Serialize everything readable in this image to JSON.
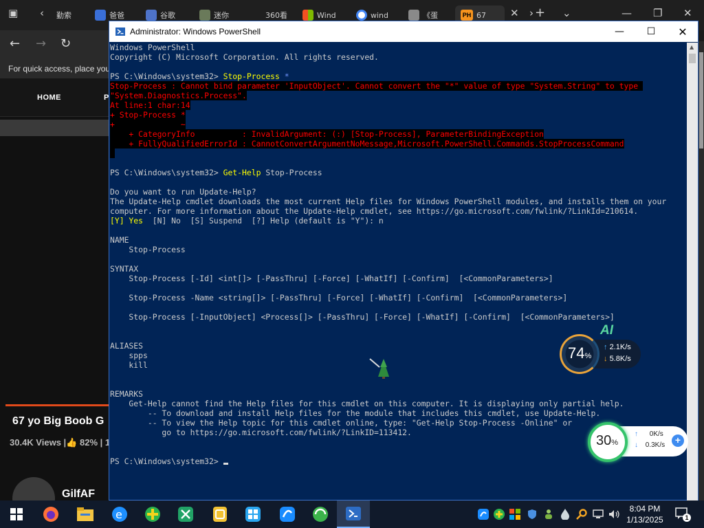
{
  "browser": {
    "tabs": [
      {
        "label": "勤索"
      },
      {
        "label": "爸爸"
      },
      {
        "label": "谷歌"
      },
      {
        "label": "迷你"
      },
      {
        "label": "360看"
      },
      {
        "label": "Wind"
      },
      {
        "label": "wind"
      },
      {
        "label": "《蛋"
      },
      {
        "label": "67"
      }
    ],
    "active_tab_badge": "PH",
    "quick_access": "For quick access, place your",
    "site": {
      "menu_home": "HOME",
      "menu_next": "P",
      "video_title": "67 yo Big Boob G",
      "views": "30.4K Views",
      "rating": "82%",
      "rating_sep": "| 1",
      "channel": "GilfAF"
    }
  },
  "powershell": {
    "title": "Administrator: Windows PowerShell",
    "lines": [
      {
        "type": "out",
        "text": "Windows PowerShell"
      },
      {
        "type": "out",
        "text": "Copyright (C) Microsoft Corporation. All rights reserved."
      },
      {
        "type": "out",
        "text": ""
      },
      {
        "type": "prompt",
        "prompt": "PS C:\\Windows\\system32> ",
        "cmd": "Stop-Process",
        "arg": " *",
        "argcolor": "#6f94ff"
      },
      {
        "type": "err",
        "text": "Stop-Process : Cannot bind parameter 'InputObject'. Cannot convert the \"*\" value of type \"System.String\" to type "
      },
      {
        "type": "err",
        "text": "\"System.Diagnostics.Process\"."
      },
      {
        "type": "err",
        "text": "At line:1 char:14"
      },
      {
        "type": "err",
        "text": "+ Stop-Process *"
      },
      {
        "type": "err",
        "text": "+              ~"
      },
      {
        "type": "err",
        "text": "    + CategoryInfo          : InvalidArgument: (:) [Stop-Process], ParameterBindingException"
      },
      {
        "type": "err",
        "text": "    + FullyQualifiedErrorId : CannotConvertArgumentNoMessage,Microsoft.PowerShell.Commands.StopProcessCommand"
      },
      {
        "type": "err",
        "text": " "
      },
      {
        "type": "out",
        "text": ""
      },
      {
        "type": "prompt",
        "prompt": "PS C:\\Windows\\system32> ",
        "cmd": "Get-Help",
        "arg": " Stop-Process",
        "argcolor": "#cccccc"
      },
      {
        "type": "out",
        "text": ""
      },
      {
        "type": "out",
        "text": "Do you want to run Update-Help?"
      },
      {
        "type": "out",
        "text": "The Update-Help cmdlet downloads the most current Help files for Windows PowerShell modules, and installs them on your"
      },
      {
        "type": "out",
        "text": "computer. For more information about the Update-Help cmdlet, see https://go.microsoft.com/fwlink/?LinkId=210614."
      },
      {
        "type": "choice",
        "yes": "[Y] Yes",
        "rest": "  [N] No  [S] Suspend  [?] Help (default is \"Y\"): n"
      },
      {
        "type": "out",
        "text": ""
      },
      {
        "type": "out",
        "text": "NAME"
      },
      {
        "type": "out",
        "text": "    Stop-Process"
      },
      {
        "type": "out",
        "text": ""
      },
      {
        "type": "out",
        "text": "SYNTAX"
      },
      {
        "type": "out",
        "text": "    Stop-Process [-Id] <int[]> [-PassThru] [-Force] [-WhatIf] [-Confirm]  [<CommonParameters>]"
      },
      {
        "type": "out",
        "text": ""
      },
      {
        "type": "out",
        "text": "    Stop-Process -Name <string[]> [-PassThru] [-Force] [-WhatIf] [-Confirm]  [<CommonParameters>]"
      },
      {
        "type": "out",
        "text": ""
      },
      {
        "type": "out",
        "text": "    Stop-Process [-InputObject] <Process[]> [-PassThru] [-Force] [-WhatIf] [-Confirm]  [<CommonParameters>]"
      },
      {
        "type": "out",
        "text": ""
      },
      {
        "type": "out",
        "text": ""
      },
      {
        "type": "out",
        "text": "ALIASES"
      },
      {
        "type": "out",
        "text": "    spps"
      },
      {
        "type": "out",
        "text": "    kill"
      },
      {
        "type": "out",
        "text": ""
      },
      {
        "type": "out",
        "text": ""
      },
      {
        "type": "out",
        "text": "REMARKS"
      },
      {
        "type": "out",
        "text": "    Get-Help cannot find the Help files for this cmdlet on this computer. It is displaying only partial help."
      },
      {
        "type": "out",
        "text": "        -- To download and install Help files for the module that includes this cmdlet, use Update-Help."
      },
      {
        "type": "out",
        "text": "        -- To view the Help topic for this cmdlet online, type: \"Get-Help Stop-Process -Online\" or"
      },
      {
        "type": "out",
        "text": "           go to https://go.microsoft.com/fwlink/?LinkID=113412."
      },
      {
        "type": "out",
        "text": ""
      },
      {
        "type": "out",
        "text": ""
      },
      {
        "type": "prompt_cursor",
        "prompt": "PS C:\\Windows\\system32> "
      }
    ]
  },
  "widgets": {
    "ai_label": "AI",
    "w1": {
      "percent": "74",
      "pct_sign": "%",
      "up": "2.1K/s",
      "down": "5.8K/s"
    },
    "w2": {
      "percent": "30",
      "pct_sign": "%",
      "up": "0K/s",
      "down": "0.3K/s",
      "plus": "+"
    }
  },
  "taskbar": {
    "time": "8:04 PM",
    "date": "1/13/2025",
    "notification_count": "1",
    "colors": {
      "bg": "#101a2b",
      "ps_bg": "#012456",
      "cmd": "#ffff00",
      "err": "#ff0000"
    }
  }
}
